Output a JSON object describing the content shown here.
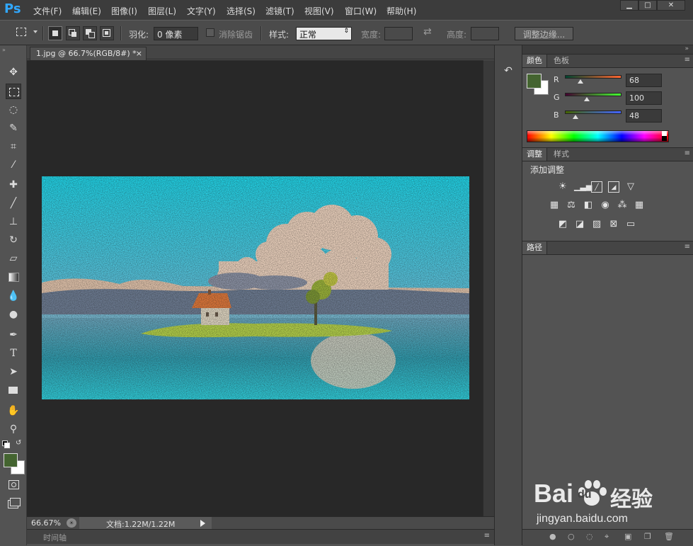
{
  "app": {
    "logo": "Ps"
  },
  "menu": [
    "文件(F)",
    "编辑(E)",
    "图像(I)",
    "图层(L)",
    "文字(Y)",
    "选择(S)",
    "滤镜(T)",
    "视图(V)",
    "窗口(W)",
    "帮助(H)"
  ],
  "window_controls": {
    "minimize": "▁",
    "maximize": "□",
    "close": "✕"
  },
  "options": {
    "feather_label": "羽化:",
    "feather_value": "0 像素",
    "antialias_label": "消除锯齿",
    "style_label": "样式:",
    "style_value": "正常",
    "width_label": "宽度:",
    "height_label": "高度:",
    "refine_button": "调整边缘..."
  },
  "document": {
    "tab_title": "1.jpg @ 66.7%(RGB/8#) *",
    "tab_close": "×",
    "zoom": "66.67%",
    "doc_size": "文档:1.22M/1.22M",
    "timeline_label": "时间轴"
  },
  "color_panel": {
    "tabs": [
      "颜色",
      "色板"
    ],
    "r_label": "R",
    "g_label": "G",
    "b_label": "B",
    "r": "68",
    "g": "100",
    "b": "48",
    "foreground": "#446430",
    "background": "#ffffff"
  },
  "adjust_panel": {
    "tabs": [
      "调整",
      "样式"
    ],
    "title": "添加调整"
  },
  "paths_panel": {
    "tabs": [
      "路径"
    ]
  },
  "watermark": {
    "brand": "Bai",
    "brand_b": "du",
    "brand_cn": "经验",
    "url": "jingyan.baidu.com"
  }
}
